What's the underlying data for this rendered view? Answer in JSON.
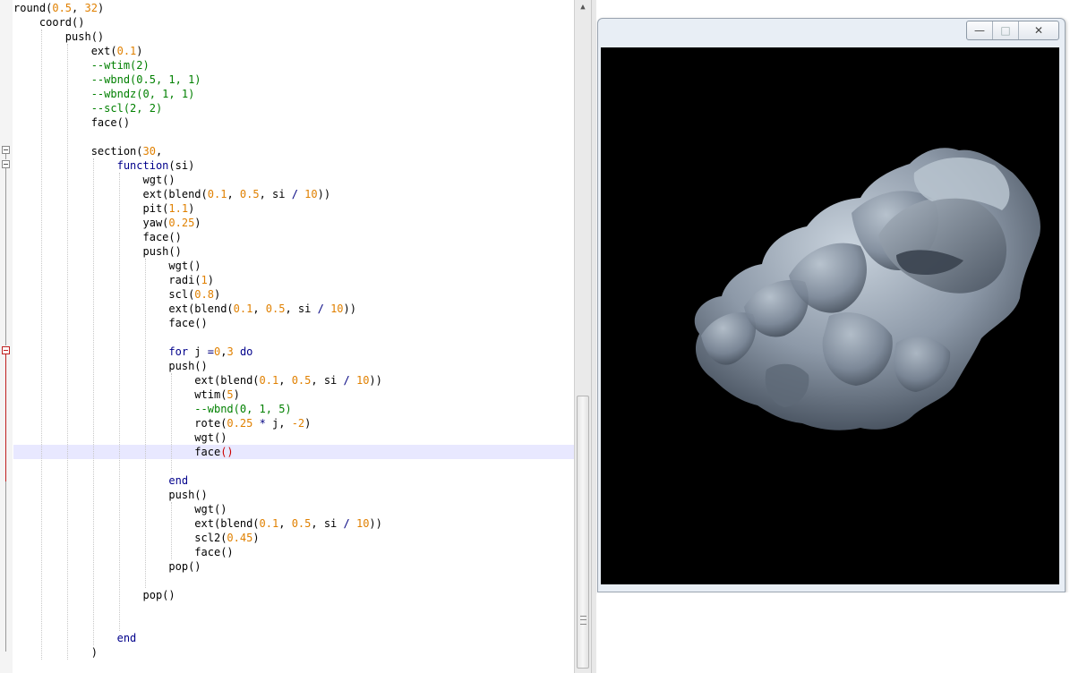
{
  "editor": {
    "lines": [
      [
        {
          "t": "round",
          "c": "fn"
        },
        {
          "t": "(",
          "c": "par"
        },
        {
          "t": "0.5",
          "c": "num"
        },
        {
          "t": ", ",
          "c": "par"
        },
        {
          "t": "32",
          "c": "num"
        },
        {
          "t": ")",
          "c": "par"
        }
      ],
      [
        {
          "t": "    coord()",
          "c": "fn"
        }
      ],
      [
        {
          "t": "        push()",
          "c": "fn"
        }
      ],
      [
        {
          "t": "            ext(",
          "c": "fn"
        },
        {
          "t": "0.1",
          "c": "num"
        },
        {
          "t": ")",
          "c": "par"
        }
      ],
      [
        {
          "t": "            --wtim(2)",
          "c": "cmt"
        }
      ],
      [
        {
          "t": "            --wbnd(0.5, 1, 1)",
          "c": "cmt"
        }
      ],
      [
        {
          "t": "            --wbndz(0, 1, 1)",
          "c": "cmt"
        }
      ],
      [
        {
          "t": "            --scl(2, 2)",
          "c": "cmt"
        }
      ],
      [
        {
          "t": "            face()",
          "c": "fn"
        }
      ],
      [
        {
          "t": "",
          "c": "fn"
        }
      ],
      [
        {
          "t": "            section(",
          "c": "fn"
        },
        {
          "t": "30",
          "c": "num"
        },
        {
          "t": ",",
          "c": "par"
        }
      ],
      [
        {
          "t": "                ",
          "c": "fn"
        },
        {
          "t": "function",
          "c": "kw"
        },
        {
          "t": "(si)",
          "c": "fn"
        }
      ],
      [
        {
          "t": "                    wgt()",
          "c": "fn"
        }
      ],
      [
        {
          "t": "                    ext(blend(",
          "c": "fn"
        },
        {
          "t": "0.1",
          "c": "num"
        },
        {
          "t": ", ",
          "c": "par"
        },
        {
          "t": "0.5",
          "c": "num"
        },
        {
          "t": ", si ",
          "c": "fn"
        },
        {
          "t": "/",
          "c": "op"
        },
        {
          "t": " ",
          "c": "fn"
        },
        {
          "t": "10",
          "c": "num"
        },
        {
          "t": "))",
          "c": "par"
        }
      ],
      [
        {
          "t": "                    pit(",
          "c": "fn"
        },
        {
          "t": "1.1",
          "c": "num"
        },
        {
          "t": ")",
          "c": "par"
        }
      ],
      [
        {
          "t": "                    yaw(",
          "c": "fn"
        },
        {
          "t": "0.25",
          "c": "num"
        },
        {
          "t": ")",
          "c": "par"
        }
      ],
      [
        {
          "t": "                    face()",
          "c": "fn"
        }
      ],
      [
        {
          "t": "                    push()",
          "c": "fn"
        }
      ],
      [
        {
          "t": "                        wgt()",
          "c": "fn"
        }
      ],
      [
        {
          "t": "                        radi(",
          "c": "fn"
        },
        {
          "t": "1",
          "c": "num"
        },
        {
          "t": ")",
          "c": "par"
        }
      ],
      [
        {
          "t": "                        scl(",
          "c": "fn"
        },
        {
          "t": "0.8",
          "c": "num"
        },
        {
          "t": ")",
          "c": "par"
        }
      ],
      [
        {
          "t": "                        ext(blend(",
          "c": "fn"
        },
        {
          "t": "0.1",
          "c": "num"
        },
        {
          "t": ", ",
          "c": "par"
        },
        {
          "t": "0.5",
          "c": "num"
        },
        {
          "t": ", si ",
          "c": "fn"
        },
        {
          "t": "/",
          "c": "op"
        },
        {
          "t": " ",
          "c": "fn"
        },
        {
          "t": "10",
          "c": "num"
        },
        {
          "t": "))",
          "c": "par"
        }
      ],
      [
        {
          "t": "                        face()",
          "c": "fn"
        }
      ],
      [
        {
          "t": "",
          "c": "fn"
        }
      ],
      [
        {
          "t": "                        ",
          "c": "fn"
        },
        {
          "t": "for",
          "c": "kw"
        },
        {
          "t": " j ",
          "c": "fn"
        },
        {
          "t": "=",
          "c": "op"
        },
        {
          "t": "0",
          "c": "num"
        },
        {
          "t": ",",
          "c": "par"
        },
        {
          "t": "3",
          "c": "num"
        },
        {
          "t": " ",
          "c": "fn"
        },
        {
          "t": "do",
          "c": "kw"
        }
      ],
      [
        {
          "t": "                        push()",
          "c": "fn"
        }
      ],
      [
        {
          "t": "                            ext(blend(",
          "c": "fn"
        },
        {
          "t": "0.1",
          "c": "num"
        },
        {
          "t": ", ",
          "c": "par"
        },
        {
          "t": "0.5",
          "c": "num"
        },
        {
          "t": ", si ",
          "c": "fn"
        },
        {
          "t": "/",
          "c": "op"
        },
        {
          "t": " ",
          "c": "fn"
        },
        {
          "t": "10",
          "c": "num"
        },
        {
          "t": "))",
          "c": "par"
        }
      ],
      [
        {
          "t": "                            wtim(",
          "c": "fn"
        },
        {
          "t": "5",
          "c": "num"
        },
        {
          "t": ")",
          "c": "par"
        }
      ],
      [
        {
          "t": "                            --wbnd(0, 1, 5)",
          "c": "cmt"
        }
      ],
      [
        {
          "t": "                            rote(",
          "c": "fn"
        },
        {
          "t": "0.25",
          "c": "num"
        },
        {
          "t": " ",
          "c": "fn"
        },
        {
          "t": "*",
          "c": "op"
        },
        {
          "t": " j, ",
          "c": "fn"
        },
        {
          "t": "-2",
          "c": "num"
        },
        {
          "t": ")",
          "c": "par"
        }
      ],
      [
        {
          "t": "                            wgt()",
          "c": "fn"
        }
      ],
      [
        {
          "t": "                            face",
          "c": "fn"
        },
        {
          "t": "()",
          "c": "parhl"
        }
      ],
      [
        {
          "t": "",
          "c": "fn"
        }
      ],
      [
        {
          "t": "                        ",
          "c": "fn"
        },
        {
          "t": "end",
          "c": "kw"
        }
      ],
      [
        {
          "t": "                        push()",
          "c": "fn"
        }
      ],
      [
        {
          "t": "                            wgt()",
          "c": "fn"
        }
      ],
      [
        {
          "t": "                            ext(blend(",
          "c": "fn"
        },
        {
          "t": "0.1",
          "c": "num"
        },
        {
          "t": ", ",
          "c": "par"
        },
        {
          "t": "0.5",
          "c": "num"
        },
        {
          "t": ", si ",
          "c": "fn"
        },
        {
          "t": "/",
          "c": "op"
        },
        {
          "t": " ",
          "c": "fn"
        },
        {
          "t": "10",
          "c": "num"
        },
        {
          "t": "))",
          "c": "par"
        }
      ],
      [
        {
          "t": "                            scl2(",
          "c": "fn"
        },
        {
          "t": "0.45",
          "c": "num"
        },
        {
          "t": ")",
          "c": "par"
        }
      ],
      [
        {
          "t": "                            face()",
          "c": "fn"
        }
      ],
      [
        {
          "t": "                        pop()",
          "c": "fn"
        }
      ],
      [
        {
          "t": "",
          "c": "fn"
        }
      ],
      [
        {
          "t": "                    pop()",
          "c": "fn"
        }
      ],
      [
        {
          "t": "",
          "c": "fn"
        }
      ],
      [
        {
          "t": "",
          "c": "fn"
        }
      ],
      [
        {
          "t": "                ",
          "c": "fn"
        },
        {
          "t": "end",
          "c": "kw"
        }
      ],
      [
        {
          "t": "            )",
          "c": "fn"
        }
      ]
    ],
    "current_line_index": 31,
    "scroll_up_arrow": "▲"
  },
  "viewer": {
    "minimize_glyph": "—",
    "maximize_glyph": "□",
    "close_glyph": "✕"
  },
  "colors": {
    "keyword": "#00008b",
    "number": "#e08000",
    "comment": "#008000",
    "canvas_background": "#000000",
    "shape": "#8d99a8"
  },
  "icons": [
    "scroll-up-arrow-icon",
    "fold-marker-icon",
    "minimize-icon",
    "maximize-icon",
    "close-icon"
  ]
}
